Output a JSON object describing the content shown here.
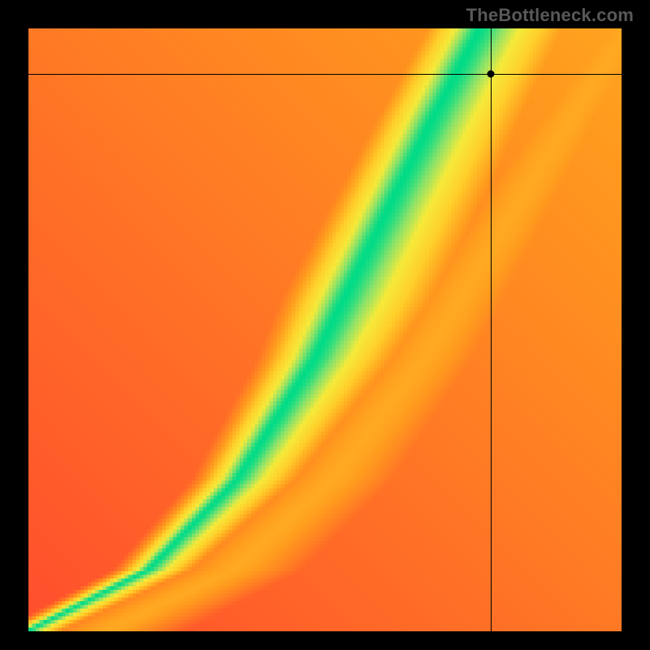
{
  "attribution": "TheBottleneck.com",
  "chart_data": {
    "type": "heatmap",
    "title": "",
    "xlabel": "",
    "ylabel": "",
    "xlim": [
      0,
      100
    ],
    "ylim": [
      0,
      100
    ],
    "grid": false,
    "legend": false,
    "colors": {
      "low": "#ff173e",
      "mid_low": "#ffb400",
      "mid": "#ffe642",
      "good": "#00e28d",
      "high_good": "#00d884"
    },
    "ridge": {
      "description": "Green optimal band running diagonally; value represents match quality (1 = perfect).",
      "points": [
        {
          "x": 0,
          "y": 0
        },
        {
          "x": 20,
          "y": 10
        },
        {
          "x": 35,
          "y": 25
        },
        {
          "x": 48,
          "y": 45
        },
        {
          "x": 58,
          "y": 65
        },
        {
          "x": 68,
          "y": 85
        },
        {
          "x": 76,
          "y": 100
        }
      ],
      "band_width_pct": 7
    },
    "crosshair": {
      "x": 78,
      "y": 92.5
    },
    "marker": {
      "x": 78,
      "y": 92.5
    }
  }
}
